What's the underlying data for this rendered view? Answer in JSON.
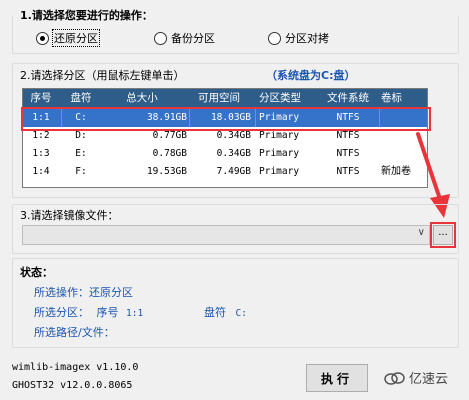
{
  "section1": {
    "title": "1.请选择您要进行的操作：",
    "options": [
      {
        "label": "还原分区",
        "selected": true
      },
      {
        "label": "备份分区",
        "selected": false
      },
      {
        "label": "分区对拷",
        "selected": false
      }
    ]
  },
  "section2": {
    "title": "2.请选择分区（用鼠标左键单击）",
    "system_disk_note": "（系统盘为C:盘）",
    "columns": [
      "序号",
      "盘符",
      "总大小",
      "可用空间",
      "分区类型",
      "文件系统",
      "卷标"
    ],
    "rows": [
      {
        "no": "1:1",
        "drive": "C:",
        "total": "38.91GB",
        "free": "18.03GB",
        "type": "Primary",
        "fs": "NTFS",
        "label": ""
      },
      {
        "no": "1:2",
        "drive": "D:",
        "total": "0.77GB",
        "free": "0.34GB",
        "type": "Primary",
        "fs": "NTFS",
        "label": ""
      },
      {
        "no": "1:3",
        "drive": "E:",
        "total": "0.78GB",
        "free": "0.34GB",
        "type": "Primary",
        "fs": "NTFS",
        "label": ""
      },
      {
        "no": "1:4",
        "drive": "F:",
        "total": "19.53GB",
        "free": "7.49GB",
        "type": "Primary",
        "fs": "NTFS",
        "label": "新加卷"
      }
    ],
    "selected_row": 0
  },
  "section3": {
    "title": "3.请选择镜像文件：",
    "image_file_value": "",
    "browse_label": "..."
  },
  "status": {
    "title": "状态：",
    "operation_label": "所选操作：",
    "operation_value": "还原分区",
    "partition_label": "所选分区：",
    "partition_no_label": "序号",
    "partition_no_value": "1:1",
    "partition_drive_label": "盘符",
    "partition_drive_value": "C:",
    "path_label": "所选路径/文件："
  },
  "footer": {
    "wimlib_version": "wimlib-imagex v1.10.0",
    "ghost_version": "GHOST32 v12.0.0.8065",
    "execute_label": "执行",
    "watermark": "亿速云"
  },
  "colors": {
    "header_bg": "#2f5d8a",
    "selected_row_bg": "#3572c9",
    "highlight_red": "#e8343a",
    "status_text": "#1a55b0"
  }
}
